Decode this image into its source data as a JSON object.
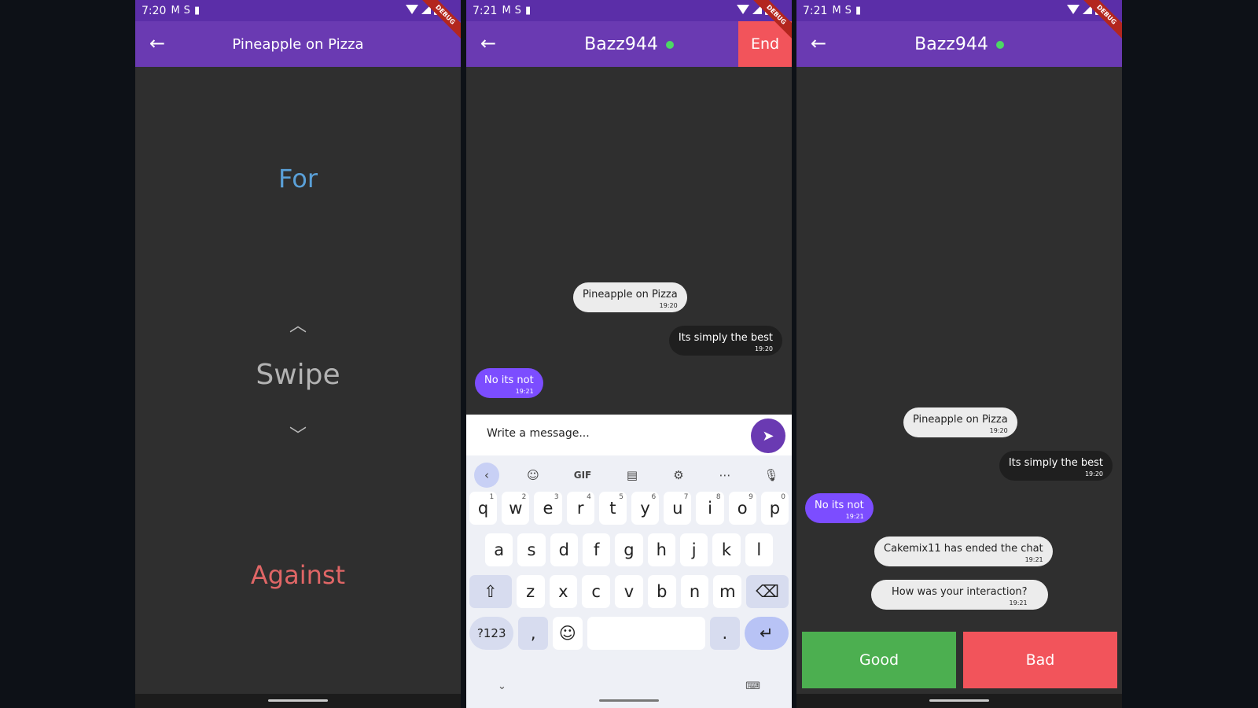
{
  "screens": [
    {
      "time": "7:20",
      "title": "Pineapple on Pizza",
      "for_label": "For",
      "swipe_label": "Swipe",
      "against_label": "Against"
    },
    {
      "time": "7:21",
      "title": "Bazz944",
      "end_label": "End",
      "messages": [
        {
          "text": "Pineapple on Pizza",
          "time": "19:20"
        },
        {
          "text": "Its simply the best",
          "time": "19:20"
        },
        {
          "text": "No its not",
          "time": "19:21"
        }
      ],
      "input_placeholder": "Write a message...",
      "keyboard": {
        "gif_label": "GIF",
        "row1": [
          "q",
          "w",
          "e",
          "r",
          "t",
          "y",
          "u",
          "i",
          "o",
          "p"
        ],
        "row1_nums": [
          "1",
          "2",
          "3",
          "4",
          "5",
          "6",
          "7",
          "8",
          "9",
          "0"
        ],
        "row2": [
          "a",
          "s",
          "d",
          "f",
          "g",
          "h",
          "j",
          "k",
          "l"
        ],
        "row3": [
          "z",
          "x",
          "c",
          "v",
          "b",
          "n",
          "m"
        ],
        "symbols_label": "?123",
        "comma": ",",
        "period": "."
      }
    },
    {
      "time": "7:21",
      "title": "Bazz944",
      "messages": [
        {
          "text": "Pineapple on Pizza",
          "time": "19:20"
        },
        {
          "text": "Its simply the best",
          "time": "19:20"
        },
        {
          "text": "No its not",
          "time": "19:21"
        },
        {
          "text": "Cakemix11 has ended the chat",
          "time": "19:21"
        },
        {
          "text": "How was your interaction?",
          "time": "19:21"
        }
      ],
      "good_label": "Good",
      "bad_label": "Bad"
    }
  ],
  "colors": {
    "app_bar": "#6a3ab2",
    "status_bar": "#5b2ea8",
    "background": "#2f2f2f",
    "for": "#5aa0d8",
    "against": "#e06666",
    "online": "#4cd964",
    "end": "#f2545b",
    "good": "#4caf50",
    "bad": "#f2545b",
    "my_bubble": "#7c4dff"
  },
  "icons": [
    "back-arrow-icon",
    "gmail-icon",
    "sim-icon",
    "sd-card-icon",
    "wifi-icon",
    "signal-icon",
    "battery-icon",
    "send-icon",
    "sticker-icon",
    "clipboard-icon",
    "gear-icon",
    "more-icon",
    "mic-icon",
    "shift-icon",
    "backspace-icon",
    "emoji-icon",
    "enter-icon"
  ]
}
